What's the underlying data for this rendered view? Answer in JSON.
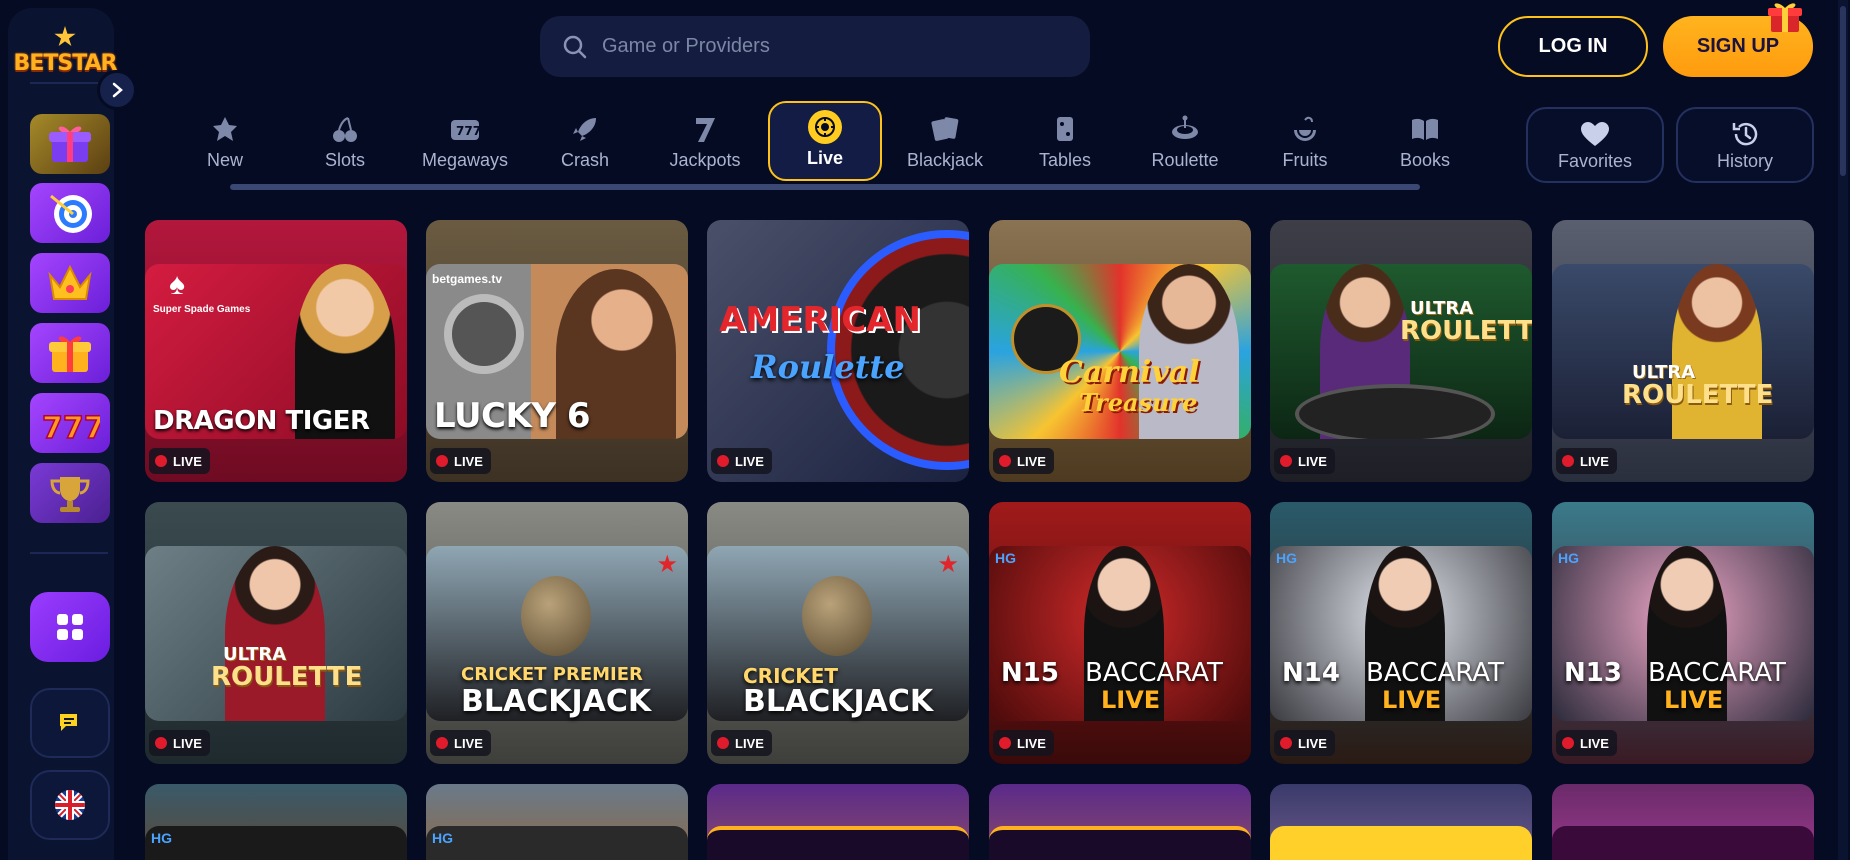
{
  "brand": {
    "logo_text": "BETSTAR"
  },
  "header": {
    "search_placeholder": "Game or Providers",
    "login_label": "LOG IN",
    "signup_label": "SIGN UP"
  },
  "sidebar": {
    "promos": [
      {
        "icon": "gift-box-icon"
      },
      {
        "icon": "target-icon"
      },
      {
        "icon": "crown-icon"
      },
      {
        "icon": "gift-icon"
      },
      {
        "icon": "slot-777-icon"
      },
      {
        "icon": "trophy-icon"
      }
    ],
    "apps_icon": "apps-grid-icon",
    "chat_icon": "chat-icon",
    "language_icon": "uk-flag-icon"
  },
  "categories": [
    {
      "label": "New",
      "icon": "new-star-icon"
    },
    {
      "label": "Slots",
      "icon": "cherries-icon"
    },
    {
      "label": "Megaways",
      "icon": "megaways-icon"
    },
    {
      "label": "Crash",
      "icon": "rocket-icon"
    },
    {
      "label": "Jackpots",
      "icon": "seven-icon"
    },
    {
      "label": "Live",
      "icon": "live-chip-icon",
      "active": true
    },
    {
      "label": "Blackjack",
      "icon": "cards-icon"
    },
    {
      "label": "Tables",
      "icon": "table-dice-icon"
    },
    {
      "label": "Roulette",
      "icon": "roulette-icon"
    },
    {
      "label": "Fruits",
      "icon": "fruit-icon"
    },
    {
      "label": "Books",
      "icon": "book-icon"
    }
  ],
  "quick_links": [
    {
      "label": "Favorites",
      "icon": "heart-icon"
    },
    {
      "label": "History",
      "icon": "history-icon"
    }
  ],
  "live_badge": "LIVE",
  "games": [
    {
      "title": "DRAGON TIGER",
      "provider": "Super Spade Games"
    },
    {
      "title": "LUCKY 6",
      "provider": "betgames.tv"
    },
    {
      "title": "AMERICAN",
      "subtitle": "Roulette"
    },
    {
      "title": "Carnival",
      "subtitle": "Treasure"
    },
    {
      "title": "ULTRA",
      "subtitle": "ROULETTE"
    },
    {
      "title": "ULTRA",
      "subtitle": "ROULETTE"
    },
    {
      "title": "ULTRA",
      "subtitle": "ROULETTE"
    },
    {
      "title": "CRICKET PREMIER",
      "subtitle": "BLACKJACK"
    },
    {
      "title": "CRICKET",
      "subtitle": "BLACKJACK"
    },
    {
      "title": "N15",
      "subtitle": "BACCARAT",
      "sub2": "LIVE"
    },
    {
      "title": "N14",
      "subtitle": "BACCARAT",
      "sub2": "LIVE"
    },
    {
      "title": "N13",
      "subtitle": "BACCARAT",
      "sub2": "LIVE"
    }
  ],
  "colors": {
    "accent": "#ffc21a",
    "background": "#050b22",
    "live_red": "#e01b2b"
  }
}
